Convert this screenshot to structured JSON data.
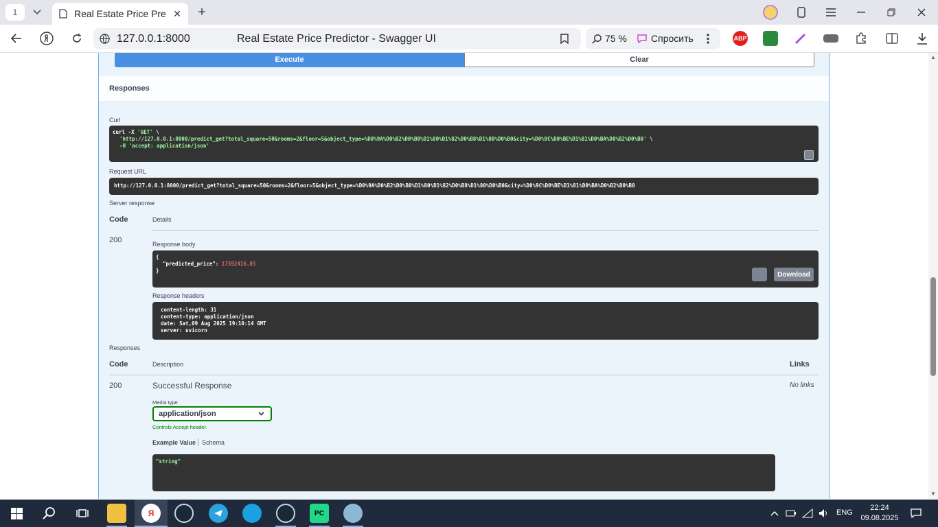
{
  "browser": {
    "tab_count": "1",
    "tab_title": "Real Estate Price Predic",
    "url": "127.0.0.1:8000",
    "page_title": "Real Estate Price Predictor - Swagger UI",
    "zoom": "75 %",
    "ask_label": "Спросить",
    "ext_abp": "ABP"
  },
  "swagger": {
    "execute_label": "Execute",
    "clear_label": "Clear",
    "responses_title": "Responses",
    "curl_label": "Curl",
    "curl_line1_a": "curl -X ",
    "curl_line1_b": "'GET'",
    "curl_line1_c": " \\",
    "curl_line2_url": "'http://127.0.0.1:8000/predict_get?total_square=50&rooms=2&floor=5&object_type=%D0%9A%D0%B2%D0%B0%D1%80%D1%82%D0%B8%D1%80%D0%B0&city=%D0%9C%D0%BE%D1%81%D0%BA%D0%B2%D0%B0'",
    "curl_line2_tail": " \\",
    "curl_line3": "-H 'accept: application/json'",
    "request_url_label": "Request URL",
    "request_url": "http://127.0.0.1:8000/predict_get?total_square=50&rooms=2&floor=5&object_type=%D0%9A%D0%B2%D0%B0%D1%80%D1%82%D0%B8%D1%80%D0%B0&city=%D0%9C%D0%BE%D1%81%D0%BA%D0%B2%D0%B0",
    "server_response_label": "Server response",
    "code_header": "Code",
    "details_header": "Details",
    "server_code": "200",
    "response_body_label": "Response body",
    "body_open": "{",
    "body_key": "\"predicted_price\"",
    "body_colon": ": ",
    "body_value": "17592416.85",
    "body_close": "}",
    "download_label": "Download",
    "response_headers_label": "Response headers",
    "headers": [
      "content-length: 31",
      "content-type: application/json",
      "date: Sat,09 Aug 2025 19:10:14 GMT",
      "server: uvicorn"
    ],
    "responses_label": "Responses",
    "description_header": "Description",
    "links_header": "Links",
    "doc_code": "200",
    "doc_description": "Successful Response",
    "no_links": "No links",
    "media_type_label": "Media type",
    "media_type_value": "application/json",
    "controls_accept": "Controls Accept header.",
    "example_value_tab": "Example Value",
    "schema_tab": "Schema",
    "example_string": "\"string\""
  },
  "taskbar": {
    "lang": "ENG",
    "time": "22:24",
    "date": "09.08.2025"
  }
}
